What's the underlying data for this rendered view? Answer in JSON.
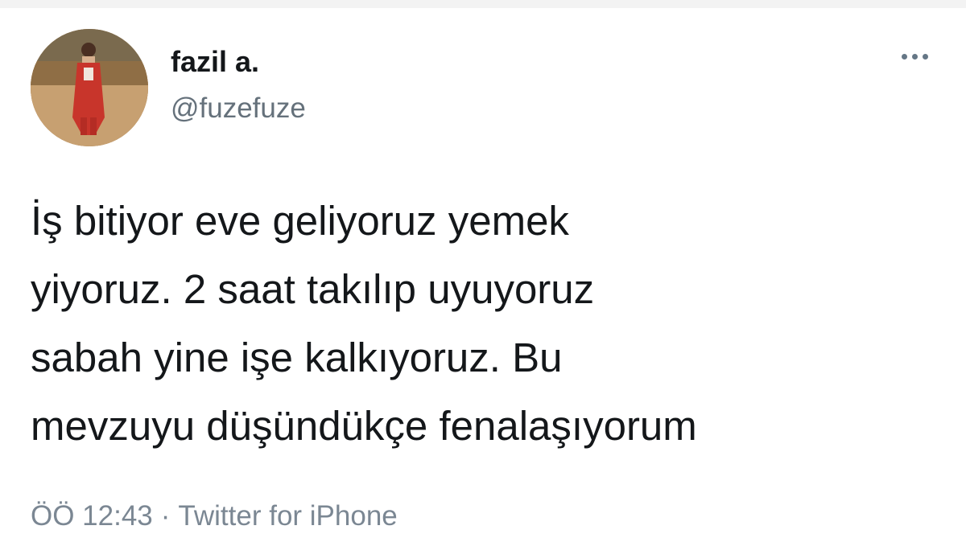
{
  "tweet": {
    "author": {
      "display_name": "fazil a.",
      "handle": "@fuzefuze"
    },
    "more_icon": "more-horizontal-icon",
    "text_lines": [
      "İş bitiyor eve geliyoruz yemek",
      "yiyoruz. 2 saat takılıp uyuyoruz",
      "sabah yine işe kalkıyoruz. Bu",
      "mevzuyu düşündükçe fenalaşıyorum"
    ],
    "meta": {
      "time": "ÖÖ 12:43",
      "separator": "·",
      "source": "Twitter for iPhone"
    }
  }
}
